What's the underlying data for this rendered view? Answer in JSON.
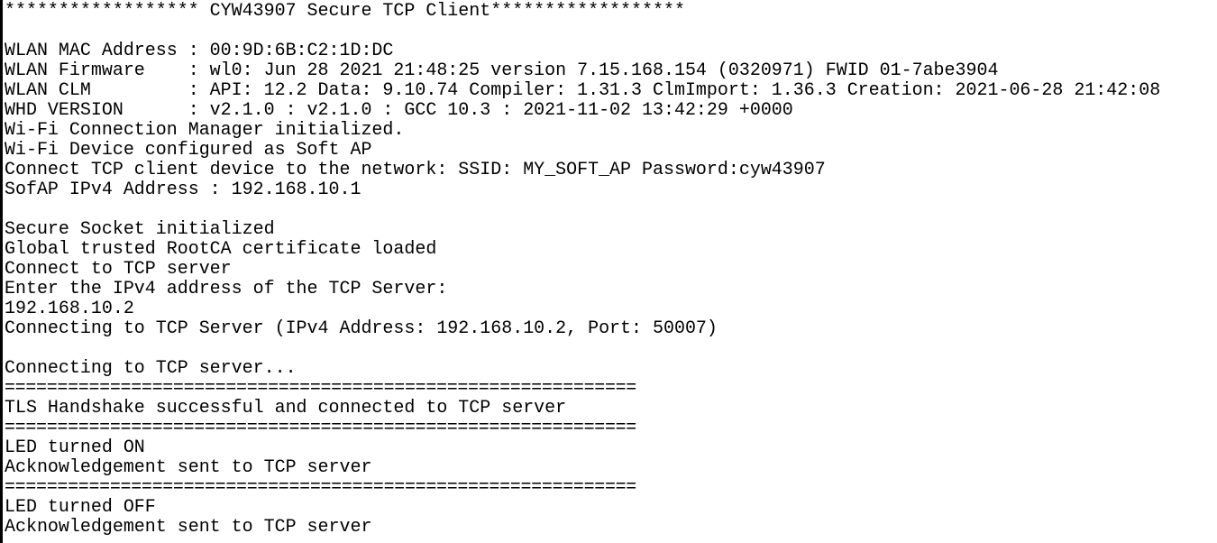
{
  "terminal": {
    "lines": [
      "****************** CYW43907 Secure TCP Client******************",
      "",
      "WLAN MAC Address : 00:9D:6B:C2:1D:DC",
      "WLAN Firmware    : wl0: Jun 28 2021 21:48:25 version 7.15.168.154 (0320971) FWID 01-7abe3904",
      "WLAN CLM         : API: 12.2 Data: 9.10.74 Compiler: 1.31.3 ClmImport: 1.36.3 Creation: 2021-06-28 21:42:08",
      "WHD VERSION      : v2.1.0 : v2.1.0 : GCC 10.3 : 2021-11-02 13:42:29 +0000",
      "Wi-Fi Connection Manager initialized.",
      "Wi-Fi Device configured as Soft AP",
      "Connect TCP client device to the network: SSID: MY_SOFT_AP Password:cyw43907",
      "SofAP IPv4 Address : 192.168.10.1",
      "",
      "Secure Socket initialized",
      "Global trusted RootCA certificate loaded",
      "Connect to TCP server",
      "Enter the IPv4 address of the TCP Server:",
      "192.168.10.2",
      "Connecting to TCP Server (IPv4 Address: 192.168.10.2, Port: 50007)",
      "",
      "Connecting to TCP server...",
      "============================================================",
      "TLS Handshake successful and connected to TCP server",
      "============================================================",
      "LED turned ON",
      "Acknowledgement sent to TCP server",
      "============================================================",
      "LED turned OFF",
      "Acknowledgement sent to TCP server"
    ]
  }
}
